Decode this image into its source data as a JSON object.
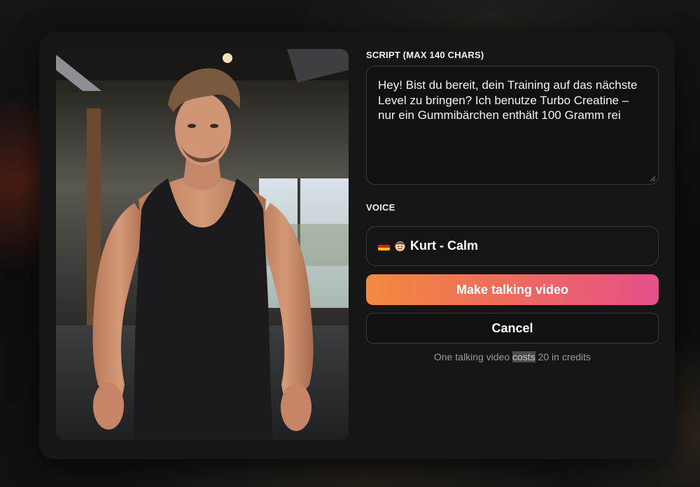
{
  "modal": {
    "script_label": "SCRIPT (MAX 140 CHARS)",
    "script_value": "Hey! Bist du bereit, dein Training auf das nächste Level zu bringen? Ich benutze Turbo Creatine – nur ein Gummibärchen enthält 100 Gramm rei",
    "voice_label": "VOICE",
    "voice": {
      "flag_icon": "germany-flag-icon",
      "avatar_icon": "man-face-icon",
      "name": "Kurt - Calm"
    },
    "make_button": "Make talking video",
    "cancel_button": "Cancel",
    "footnote": {
      "before": "One talking video",
      "highlight": "costs",
      "after": "20 in credits"
    }
  },
  "colors": {
    "modal_bg": "#161616",
    "gradient_start": "#f28a3f",
    "gradient_end": "#e6508a"
  }
}
